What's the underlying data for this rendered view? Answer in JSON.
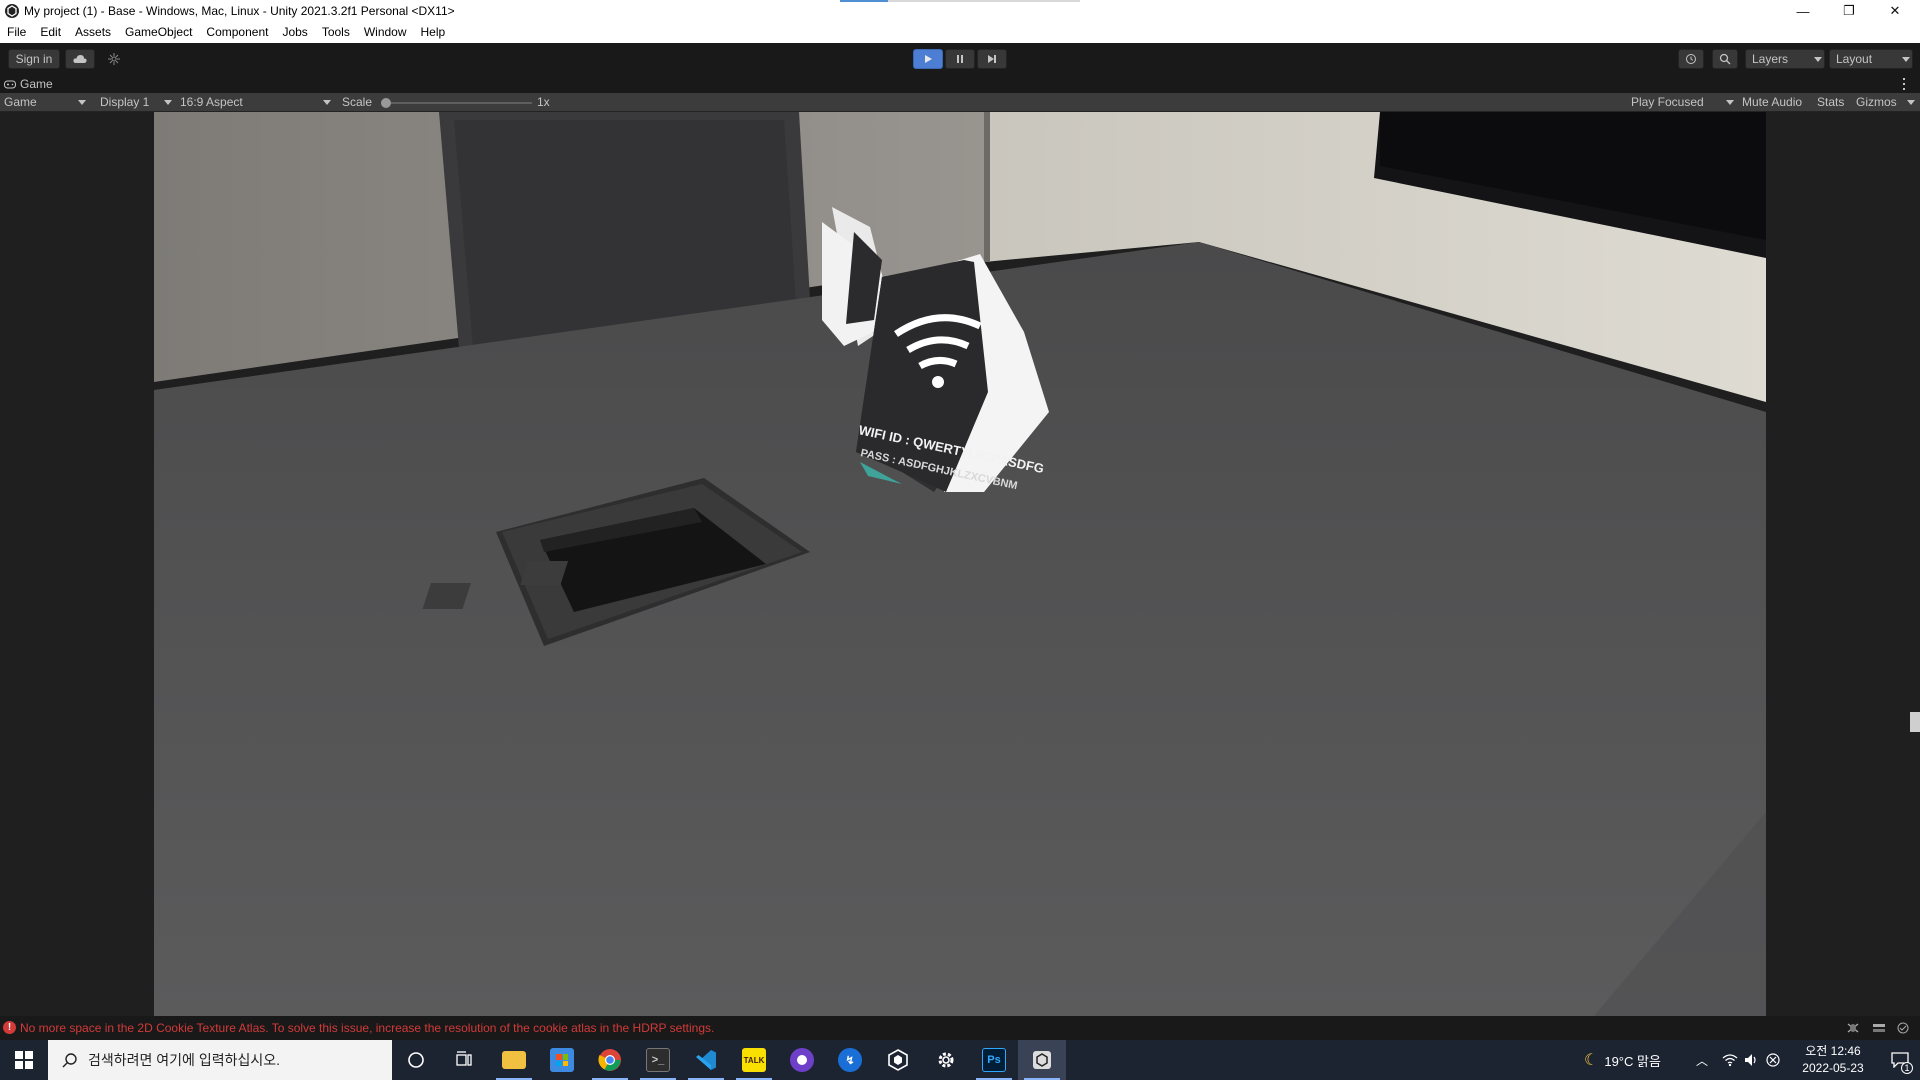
{
  "window": {
    "title": "My project (1) - Base - Windows, Mac, Linux - Unity 2021.3.2f1 Personal <DX11>",
    "minimize_glyph": "—",
    "maximize_glyph": "❐",
    "close_glyph": "✕"
  },
  "menu": [
    "File",
    "Edit",
    "Assets",
    "GameObject",
    "Component",
    "Jobs",
    "Tools",
    "Window",
    "Help"
  ],
  "toolbar": {
    "sign_in": "Sign in",
    "layers": "Layers",
    "layout": "Layout"
  },
  "tab": {
    "label": "Game"
  },
  "game_toolbar": {
    "mode": "Game",
    "display": "Display 1",
    "aspect": "16:9 Aspect",
    "scale_label": "Scale",
    "scale_value": "1x",
    "scale_fraction": 0,
    "play_focused": "Play Focused",
    "mute_audio": "Mute Audio",
    "stats": "Stats",
    "gizmos": "Gizmos"
  },
  "scene": {
    "sign_line1": "WIFI ID : QWERTYUIOPASDFG",
    "sign_line2": "PASS : ASDFGHJKLZXCVBNM"
  },
  "status": {
    "message": "No more space in the 2D Cookie Texture Atlas. To solve this issue, increase the resolution of the cookie atlas in the HDRP settings."
  },
  "taskbar": {
    "search_placeholder": "검색하려면 여기에 입력하십시오.",
    "weather": "19°C 맑음",
    "time": "오전 12:46",
    "date": "2022-05-23",
    "notification_count": "1",
    "apps": [
      "cortana-icon",
      "task-view-icon",
      "file-explorer-icon",
      "store-icon",
      "chrome-icon",
      "terminal-icon",
      "vscode-icon",
      "kakaotalk-icon",
      "github-desktop-icon",
      "sourcetree-icon",
      "unity-hub-icon",
      "settings-icon",
      "photoshop-icon",
      "unity-icon"
    ]
  },
  "colors": {
    "unity_toolbar": "#191919",
    "play_active": "#4c7fd4",
    "error_red": "#d23a3a",
    "taskbar": "#1c2331"
  }
}
